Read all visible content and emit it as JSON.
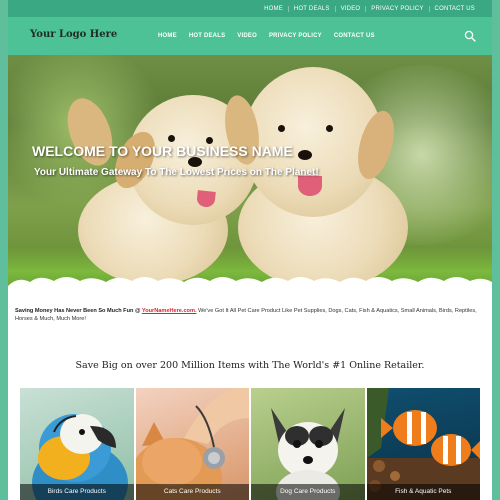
{
  "topbar": {
    "links": [
      "HOME",
      "HOT DEALS",
      "VIDEO",
      "PRIVACY POLICY",
      "CONTACT US"
    ]
  },
  "header": {
    "logo": "Your Logo Here",
    "nav": [
      "HOME",
      "HOT DEALS",
      "VIDEO",
      "PRIVACY POLICY",
      "CONTACT US"
    ],
    "search_icon": "search-icon"
  },
  "hero": {
    "title": "WELCOME TO YOUR BUSINESS NAME",
    "subtitle": "Your Ultimate Gateway To The Lowest Prices on The Planet!"
  },
  "intro": {
    "lead": "Saving Money Has Never Been So Much Fun @ ",
    "site": "YourNameHere.com.",
    "body": " We've Got It All Pet Care Product Like Pet Supplies, Dogs, Cats, Fish & Aquatics, Small Animals, Birds, Reptiles, Horses & Much, Much More!"
  },
  "tagline": "Save Big on over 200 Million Items with The World's #1 Online Retailer.",
  "products": [
    {
      "label": "Birds Care Products"
    },
    {
      "label": "Cats Care Products"
    },
    {
      "label": "Dog Care Products"
    },
    {
      "label": "Fish & Aquatic Pets"
    }
  ],
  "colors": {
    "brand_green": "#4cc296",
    "topbar_green": "#3aa882",
    "site_link_red": "#d6262c"
  }
}
